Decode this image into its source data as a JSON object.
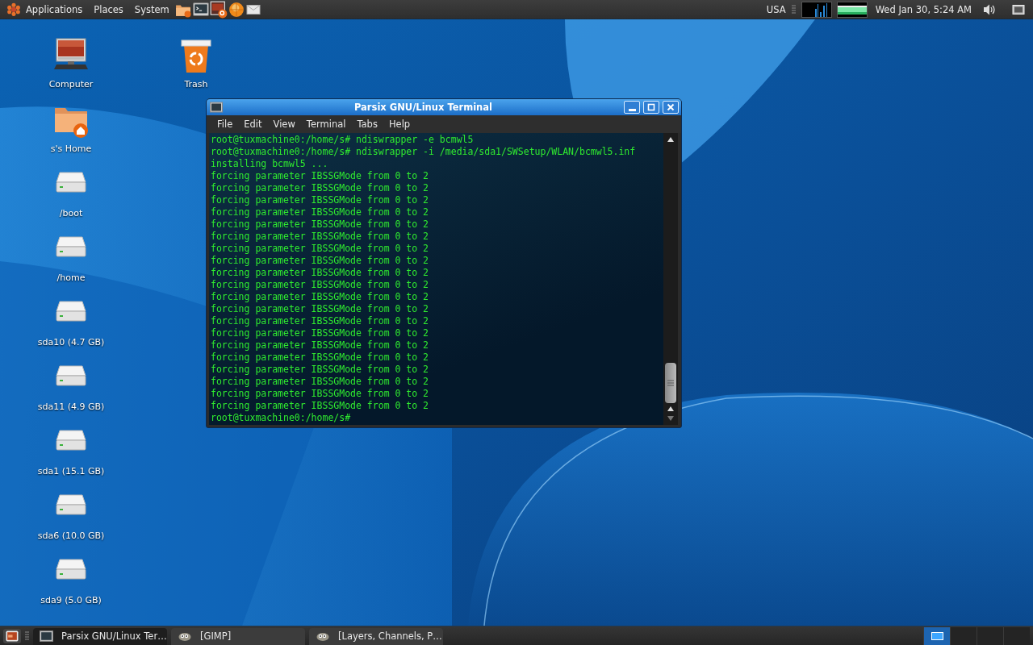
{
  "top_panel": {
    "menus": [
      {
        "label": "Applications",
        "kind": "main"
      },
      {
        "label": "Places",
        "kind": "plain"
      },
      {
        "label": "System",
        "kind": "plain"
      }
    ],
    "keyboard_layout": "USA",
    "clock": "Wed Jan 30,  5:24 AM"
  },
  "desktop": {
    "icons": [
      {
        "label": "Computer",
        "kind": "computer"
      },
      {
        "label": "s's Home",
        "kind": "home"
      },
      {
        "label": "/boot",
        "kind": "drive"
      },
      {
        "label": "/home",
        "kind": "drive"
      },
      {
        "label": "sda10 (4.7 GB)",
        "kind": "drive"
      },
      {
        "label": "sda11 (4.9 GB)",
        "kind": "drive"
      },
      {
        "label": "sda1 (15.1 GB)",
        "kind": "drive"
      },
      {
        "label": "sda6 (10.0 GB)",
        "kind": "drive"
      },
      {
        "label": "sda9 (5.0 GB)",
        "kind": "drive"
      },
      {
        "label": "Trash",
        "kind": "trash"
      }
    ]
  },
  "terminal": {
    "title": "Parsix GNU/Linux Terminal",
    "menu": [
      "File",
      "Edit",
      "View",
      "Terminal",
      "Tabs",
      "Help"
    ],
    "lines": [
      "root@tuxmachine0:/home/s# ndiswrapper -e bcmwl5",
      "root@tuxmachine0:/home/s# ndiswrapper -i /media/sda1/SWSetup/WLAN/bcmwl5.inf",
      "installing bcmwl5 ...",
      "forcing parameter IBSSGMode from 0 to 2",
      "forcing parameter IBSSGMode from 0 to 2",
      "forcing parameter IBSSGMode from 0 to 2",
      "forcing parameter IBSSGMode from 0 to 2",
      "forcing parameter IBSSGMode from 0 to 2",
      "forcing parameter IBSSGMode from 0 to 2",
      "forcing parameter IBSSGMode from 0 to 2",
      "forcing parameter IBSSGMode from 0 to 2",
      "forcing parameter IBSSGMode from 0 to 2",
      "forcing parameter IBSSGMode from 0 to 2",
      "forcing parameter IBSSGMode from 0 to 2",
      "forcing parameter IBSSGMode from 0 to 2",
      "forcing parameter IBSSGMode from 0 to 2",
      "forcing parameter IBSSGMode from 0 to 2",
      "forcing parameter IBSSGMode from 0 to 2",
      "forcing parameter IBSSGMode from 0 to 2",
      "forcing parameter IBSSGMode from 0 to 2",
      "forcing parameter IBSSGMode from 0 to 2",
      "forcing parameter IBSSGMode from 0 to 2",
      "forcing parameter IBSSGMode from 0 to 2",
      "root@tuxmachine0:/home/s#"
    ]
  },
  "bottom_panel": {
    "tasks": [
      {
        "label": "Parsix GNU/Linux Ter…",
        "kind": "terminal",
        "selected": true
      },
      {
        "label": "[GIMP]",
        "kind": "gimp",
        "selected": false
      },
      {
        "label": "[Layers, Channels, P…",
        "kind": "gimp",
        "selected": false
      }
    ],
    "workspaces": [
      {
        "selected": true
      },
      {
        "selected": false
      },
      {
        "selected": false
      },
      {
        "selected": false
      }
    ]
  }
}
